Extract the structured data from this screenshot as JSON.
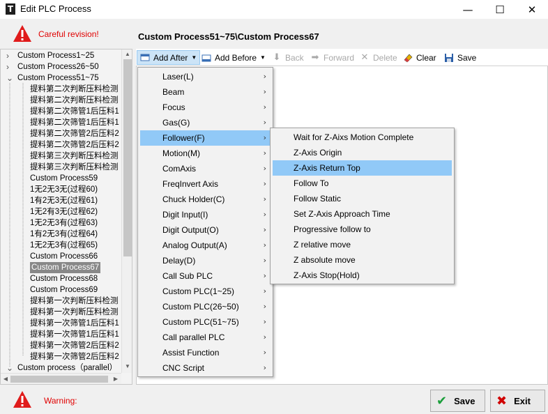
{
  "window": {
    "app_icon": "T",
    "title": "Edit PLC Process",
    "minimize": "—",
    "maximize": "☐",
    "close": "✕"
  },
  "header": {
    "warning_text": "Careful revision!",
    "process_path": "Custom Process51~75\\Custom Process67"
  },
  "tree": {
    "items": [
      {
        "label": "Custom Process1~25",
        "expander": "›"
      },
      {
        "label": "Custom Process26~50",
        "expander": "›"
      },
      {
        "label": "Custom Process51~75",
        "expander": "⌄"
      },
      {
        "label": "提料第二次判断压料检测"
      },
      {
        "label": "提料第二次判断压料检测"
      },
      {
        "label": "提料第二次筛管1后压料1"
      },
      {
        "label": "提料第二次筛管1后压料1"
      },
      {
        "label": "提料第二次筛管2后压料2"
      },
      {
        "label": "提料第二次筛管2后压料2"
      },
      {
        "label": "提料第三次判断压料检测"
      },
      {
        "label": "提料第三次判断压料检测"
      },
      {
        "label": "Custom Process59"
      },
      {
        "label": "1无2无3无(过程60)"
      },
      {
        "label": "1有2无3无(过程61)"
      },
      {
        "label": "1无2有3无(过程62)"
      },
      {
        "label": "1无2无3有(过程63)"
      },
      {
        "label": "1有2无3有(过程64)"
      },
      {
        "label": "1无2无3有(过程65)"
      },
      {
        "label": "Custom Process66"
      },
      {
        "label": "Custom Process67",
        "selected": true
      },
      {
        "label": "Custom Process68"
      },
      {
        "label": "Custom Process69"
      },
      {
        "label": "提料第一次判断压料检测"
      },
      {
        "label": "提料第一次判断压料检测"
      },
      {
        "label": "提料第一次筛管1后压料1"
      },
      {
        "label": "提料第一次筛管1后压料1"
      },
      {
        "label": "提料第一次筛管2后压料2"
      },
      {
        "label": "提料第一次筛管2后压料2"
      },
      {
        "label": "Custom process（parallel）",
        "expander": "⌄"
      }
    ]
  },
  "toolbar": {
    "add_after": "Add After",
    "add_before": "Add Before",
    "back": "Back",
    "forward": "Forward",
    "delete": "Delete",
    "clear": "Clear",
    "save": "Save"
  },
  "main_menu": {
    "items": [
      {
        "label": "Laser(L)"
      },
      {
        "label": "Beam"
      },
      {
        "label": "Focus"
      },
      {
        "label": "Gas(G)"
      },
      {
        "label": "Follower(F)",
        "highlighted": true
      },
      {
        "label": "Motion(M)"
      },
      {
        "label": "ComAxis"
      },
      {
        "label": "FreqInvert Axis"
      },
      {
        "label": "Chuck Holder(C)"
      },
      {
        "label": "Digit Input(I)"
      },
      {
        "label": "Digit Output(O)"
      },
      {
        "label": "Analog Output(A)"
      },
      {
        "label": "Delay(D)"
      },
      {
        "label": "Call Sub PLC"
      },
      {
        "label": "Custom PLC(1~25)"
      },
      {
        "label": "Custom PLC(26~50)"
      },
      {
        "label": "Custom PLC(51~75)"
      },
      {
        "label": "Call parallel PLC"
      },
      {
        "label": "Assist Function"
      },
      {
        "label": "CNC Script"
      }
    ]
  },
  "follower_menu": {
    "items": [
      {
        "label": "Wait for Z-Aixs Motion Complete"
      },
      {
        "label": "Z-Axis Origin"
      },
      {
        "label": "Z-Axis Return Top",
        "highlighted": true
      },
      {
        "label": "Follow To"
      },
      {
        "label": "Follow Static"
      },
      {
        "label": "Set Z-Axis Approach Time"
      },
      {
        "label": "Progressive follow to"
      },
      {
        "label": "Z relative move"
      },
      {
        "label": "Z absolute move"
      },
      {
        "label": "Z-Axis Stop(Hold)"
      }
    ]
  },
  "footer": {
    "warning_label": "Warning:",
    "save": "Save",
    "exit": "Exit"
  },
  "colors": {
    "warning_red": "#e00000",
    "menu_highlight": "#91c9f7",
    "tree_selected": "#888888",
    "save_check": "#1a9e3a",
    "exit_x": "#d00000"
  },
  "icons": {
    "warning": "warning-triangle-icon",
    "add_after": "add-after-icon",
    "add_before": "add-before-icon",
    "back": "arrow-down-icon",
    "forward": "arrow-right-icon",
    "delete": "x-icon",
    "clear": "eraser-icon",
    "save": "floppy-disk-icon",
    "submenu": "chevron-right-icon"
  }
}
